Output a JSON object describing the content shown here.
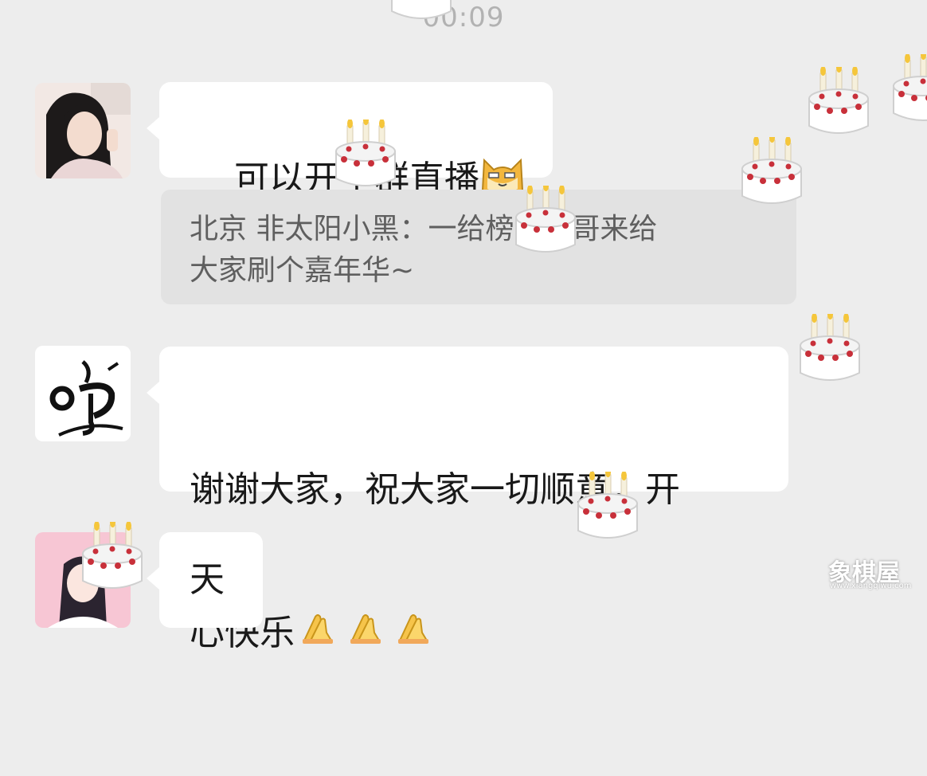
{
  "timestamp": "00:09",
  "messages": [
    {
      "text": "可以开个群直播",
      "emoji": "cat-face-emoji"
    },
    {
      "quote": "北京 非太阳小黑：一给榜一大哥来给\n大家刷个嘉年华~"
    },
    {
      "line1": "谢谢大家，祝大家一切顺意，开",
      "line2": "心快乐",
      "emoji": "folded-hands-emoji"
    },
    {
      "text": "天"
    }
  ],
  "watermark": {
    "main": "象棋屋",
    "sub": "www.xiangqiwu.com"
  },
  "colors": {
    "background": "#ededed",
    "bubble": "#ffffff",
    "quote_bg": "#e2e2e2",
    "text": "#191919",
    "quote_text": "#5f5f5f",
    "timestamp": "#b2b2b2"
  },
  "overlay_icons": "birthday-cake-icon"
}
